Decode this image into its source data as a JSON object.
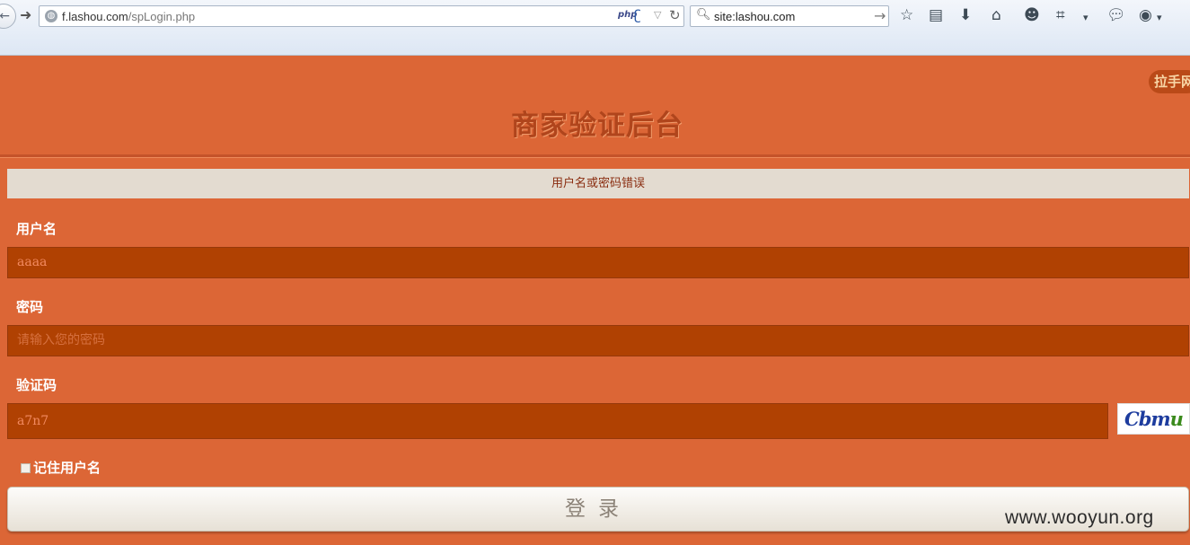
{
  "browser": {
    "url_host": "f.lashou.com",
    "url_path": "/spLogin.php",
    "php_badge": "php",
    "search_query": "site:lashou.com"
  },
  "page": {
    "logo_text": "拉手网",
    "title": "商家验证后台",
    "error_message": "用户名或密码错误",
    "username": {
      "label": "用户名",
      "value": "aaaa"
    },
    "password": {
      "label": "密码",
      "placeholder": "请输入您的密码"
    },
    "captcha": {
      "label": "验证码",
      "value": "a7n7"
    },
    "captcha_image_text": {
      "part1": "Cbm",
      "part2": "u"
    },
    "remember_label": "记住用户名",
    "login_button": "登录"
  },
  "watermark": "www.wooyun.org",
  "colors": {
    "background": "#dc6636",
    "input_bg": "#b04102",
    "error_bar": "#e3dbd0"
  }
}
